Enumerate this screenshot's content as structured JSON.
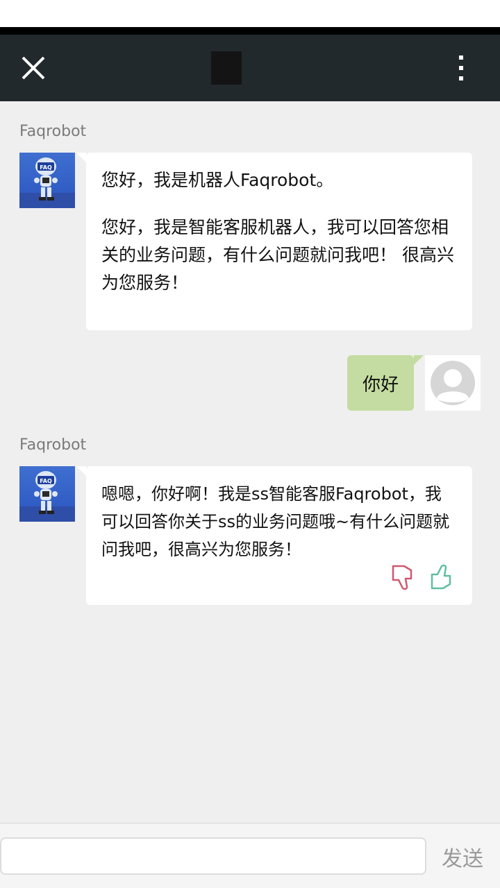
{
  "messages": [
    {
      "sender": "Faqrobot",
      "lines": [
        "您好，我是机器人Faqrobot。",
        "您好，我是智能客服机器人，我可以回答您相关的业务问题，有什么问题就问我吧！ 很高兴为您服务！"
      ]
    },
    {
      "sender": "Faqrobot",
      "lines": [
        "嗯嗯，你好啊！我是ss智能客服Faqrobot，我可以回答你关于ss的业务问题哦~有什么问题就问我吧，很高兴为您服务！"
      ]
    }
  ],
  "user_message": "你好",
  "avatar_label": "FAQ",
  "input": {
    "value": "",
    "placeholder": ""
  },
  "send_label": "发送",
  "icons": {
    "close": "close-icon",
    "more": "more-vertical-icon",
    "thumb_down": "thumb-down-icon",
    "thumb_up": "thumb-up-icon"
  },
  "colors": {
    "header": "#22292c",
    "user_bubble": "#c4dca1",
    "background": "#efefef"
  }
}
